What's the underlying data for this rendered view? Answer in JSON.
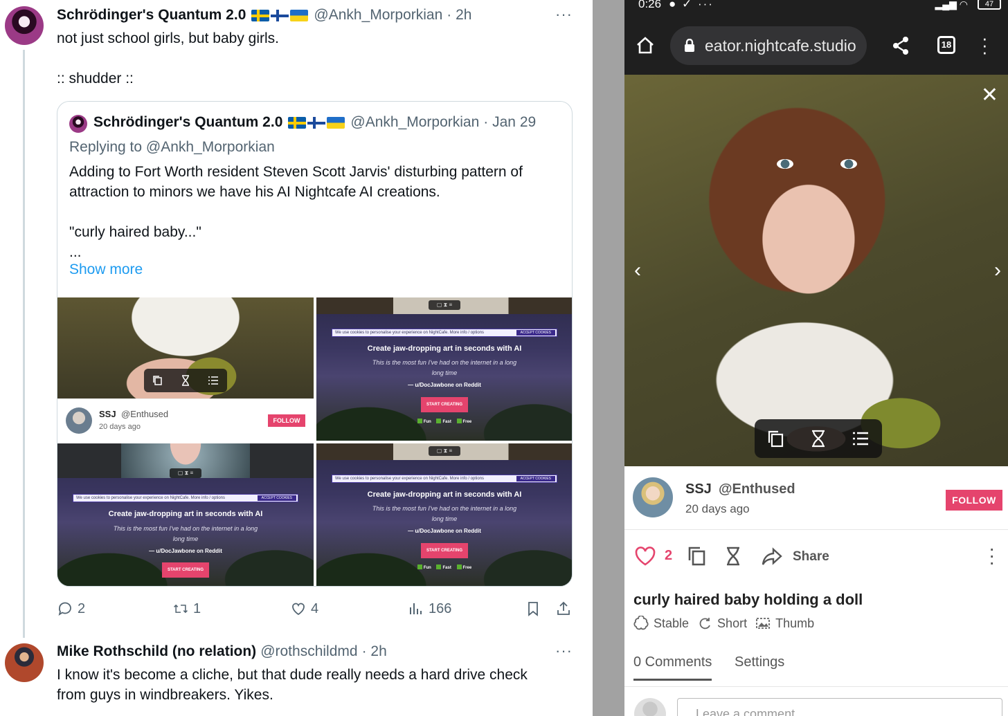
{
  "tweet1": {
    "name": "Schrödinger's Quantum 2.0",
    "handle": "@Ankh_Morporkian",
    "time": "· 2h",
    "more": "···",
    "text": "not just school girls, but baby girls.\n\n:: shudder ::"
  },
  "quote": {
    "name": "Schrödinger's Quantum 2.0",
    "handle": "@Ankh_Morporkian",
    "time": "· Jan 29",
    "replying": "Replying to @Ankh_Morporkian",
    "text": "Adding to Fort Worth resident  Steven Scott Jarvis' disturbing pattern of attraction to minors we have his AI Nightcafe AI creations.\n\n\"curly haired baby...\"\n...",
    "show_more": "Show more",
    "mini_profile": {
      "name": "SSJ",
      "handle": "@Enthused",
      "ago": "20 days ago",
      "follow": "FOLLOW"
    },
    "nightcafe": {
      "cookie": "We use cookies to personalise your experience on NightCafe. More info / options",
      "accept": "ACCEPT COOKIES",
      "title": "Create jaw-dropping art in seconds with AI",
      "quote": "This is the most fun I've had on the internet in a long long time",
      "by": "— u/DocJawbone on Reddit",
      "cta": "START CREATING",
      "checks": [
        "Fun",
        "Fast",
        "Free"
      ]
    }
  },
  "tweet1_actions": {
    "replies": "2",
    "retweets": "1",
    "likes": "4",
    "views": "166"
  },
  "tweet2": {
    "name": "Mike Rothschild (no relation)",
    "handle": "@rothschildmd",
    "time": "· 2h",
    "more": "···",
    "text": "I know it's become a cliche, but that dude really needs a hard drive check\nfrom guys in windbreakers. Yikes."
  },
  "phone": {
    "status": {
      "time": "0:26",
      "notif_dots": "···",
      "battery": "47"
    },
    "url": "eator.nightcafe.studio",
    "tab_count": "18",
    "creator": {
      "name": "SSJ",
      "handle": "@Enthused",
      "ago": "20 days ago",
      "follow": "FOLLOW"
    },
    "likes": "2",
    "share": "Share",
    "title": "curly haired baby holding a doll",
    "tags": [
      "Stable",
      "Short",
      "Thumb"
    ],
    "tabs": [
      "0 Comments",
      "Settings"
    ],
    "comment_placeholder": "Leave a comment"
  },
  "colors": {
    "accent_blue": "#1d9bf0",
    "nightcafe_pink": "#e5446d",
    "muted": "#536471"
  }
}
